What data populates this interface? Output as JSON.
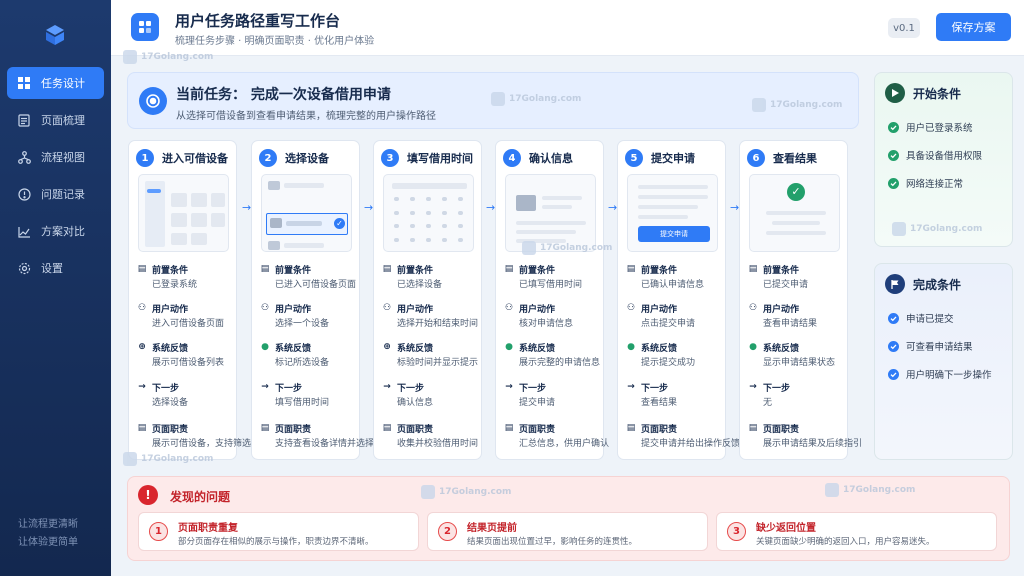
{
  "sidebar": {
    "items": [
      {
        "label": "任务设计",
        "icon": "grid-icon",
        "active": true
      },
      {
        "label": "页面梳理",
        "icon": "document-icon",
        "active": false
      },
      {
        "label": "流程视图",
        "icon": "flow-icon",
        "active": false
      },
      {
        "label": "问题记录",
        "icon": "alert-icon",
        "active": false
      },
      {
        "label": "方案对比",
        "icon": "compare-icon",
        "active": false
      },
      {
        "label": "设置",
        "icon": "gear-icon",
        "active": false
      }
    ],
    "footer_line1": "让流程更清晰",
    "footer_line2": "让体验更简单"
  },
  "header": {
    "title": "用户任务路径重写工作台",
    "subtitle": "梳理任务步骤 · 明确页面职责 · 优化用户体验",
    "version": "v0.1",
    "save_label": "保存方案"
  },
  "task": {
    "title": "当前任务： 完成一次设备借用申请",
    "subtitle": "从选择可借设备到查看申请结果，梳理完整的用户操作路径"
  },
  "labels": {
    "pre": "前置条件",
    "action": "用户动作",
    "feedback": "系统反馈",
    "next": "下一步",
    "duty": "页面职责"
  },
  "steps": [
    {
      "num": "1",
      "name": "进入可借设备",
      "pre": "已登录系统",
      "action": "进入可借设备页面",
      "feedback": "展示可借设备列表",
      "next": "选择设备",
      "duty": "展示可借设备，支持筛选"
    },
    {
      "num": "2",
      "name": "选择设备",
      "pre": "已进入可借设备页面",
      "action": "选择一个设备",
      "feedback": "标记所选设备",
      "next": "填写借用时间",
      "duty": "支持查看设备详情并选择"
    },
    {
      "num": "3",
      "name": "填写借用时间",
      "pre": "已选择设备",
      "action": "选择开始和结束时间",
      "feedback": "标验时间并显示提示",
      "next": "确认信息",
      "duty": "收集并校验借用时间"
    },
    {
      "num": "4",
      "name": "确认信息",
      "pre": "已填写借用时间",
      "action": "核对申请信息",
      "feedback": "展示完整的申请信息",
      "next": "提交申请",
      "duty": "汇总信息，供用户确认"
    },
    {
      "num": "5",
      "name": "提交申请",
      "pre": "已确认申请信息",
      "action": "点击提交申请",
      "feedback": "提示提交成功",
      "next": "查看结果",
      "duty": "提交申请并给出操作反馈",
      "mock_button": "提交申请"
    },
    {
      "num": "6",
      "name": "查看结果",
      "pre": "已提交申请",
      "action": "查看申请结果",
      "feedback": "显示申请结果状态",
      "next": "无",
      "duty": "展示申请结果及后续指引"
    }
  ],
  "start_conditions": {
    "title": "开始条件",
    "items": [
      "用户已登录系统",
      "具备设备借用权限",
      "网络连接正常"
    ]
  },
  "done_conditions": {
    "title": "完成条件",
    "items": [
      "申请已提交",
      "可查看申请结果",
      "用户明确下一步操作"
    ]
  },
  "problems": {
    "title": "发现的问题",
    "items": [
      {
        "num": "1",
        "title": "页面职责重复",
        "desc": "部分页面存在相似的展示与操作，职责边界不清晰。"
      },
      {
        "num": "2",
        "title": "结果页提前",
        "desc": "结果页面出现位置过早，影响任务的连贯性。"
      },
      {
        "num": "3",
        "title": "缺少返回位置",
        "desc": "关键页面缺少明确的返回入口，用户容易迷失。"
      }
    ]
  },
  "watermark": "17Golang.com",
  "colors": {
    "accent": "#2f7bf6",
    "success": "#22a06b",
    "danger": "#d9262e",
    "sidebar": "#1d3a6e"
  }
}
